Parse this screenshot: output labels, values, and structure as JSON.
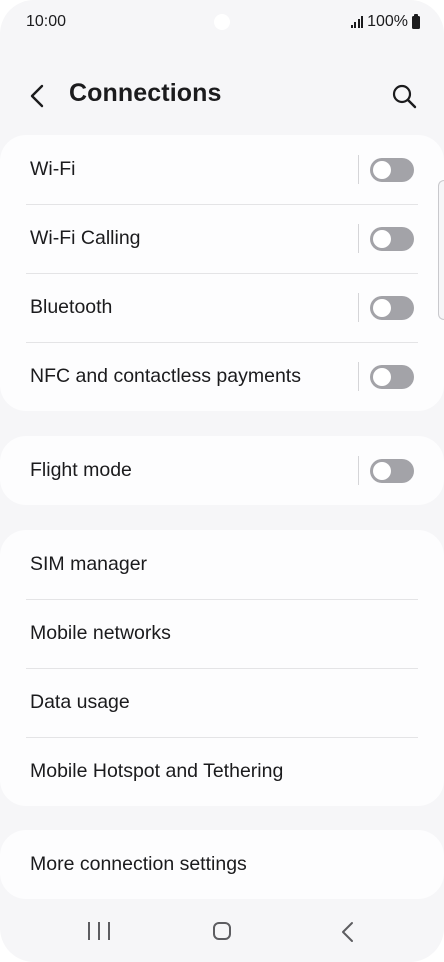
{
  "status_bar": {
    "time": "10:00",
    "battery": "100%"
  },
  "header": {
    "title": "Connections",
    "back_icon": "chevron-left-icon",
    "search_icon": "search-icon"
  },
  "groups": [
    {
      "items": [
        {
          "label": "Wi-Fi",
          "toggle": false
        },
        {
          "label": "Wi-Fi Calling",
          "toggle": false
        },
        {
          "label": "Bluetooth",
          "toggle": false
        },
        {
          "label": "NFC and contactless payments",
          "toggle": false
        }
      ]
    },
    {
      "items": [
        {
          "label": "Flight mode",
          "toggle": false
        }
      ]
    },
    {
      "items": [
        {
          "label": "SIM manager"
        },
        {
          "label": "Mobile networks"
        },
        {
          "label": "Data usage"
        },
        {
          "label": "Mobile Hotspot and Tethering"
        }
      ]
    },
    {
      "items": [
        {
          "label": "More connection settings"
        }
      ]
    }
  ],
  "colors": {
    "background": "#f6f6f8",
    "card": "#fdfdfe",
    "text": "#1b1b1d",
    "toggle_off": "#a3a3a8"
  }
}
